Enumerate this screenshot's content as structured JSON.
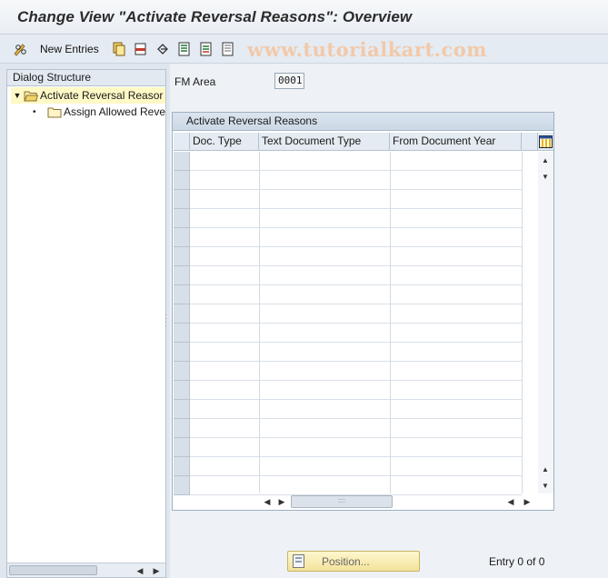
{
  "title": "Change View \"Activate Reversal Reasons\": Overview",
  "toolbar": {
    "new_entries_label": "New Entries",
    "watermark": "www.tutorialkart.com"
  },
  "dialog_structure": {
    "header": "Dialog Structure",
    "items": [
      {
        "label": "Activate Reversal Reasor",
        "selected": true
      },
      {
        "label": "Assign Allowed Reve",
        "selected": false
      }
    ]
  },
  "fm_area": {
    "label": "FM Area",
    "value": "0001"
  },
  "table": {
    "title": "Activate Reversal Reasons",
    "columns": [
      "Doc. Type",
      "Text Document Type",
      "From Document Year"
    ],
    "rows": []
  },
  "position_button": "Position...",
  "entry_info": "Entry 0 of 0",
  "colors": {
    "selected_bg": "#fff9c6",
    "button_yellow": "#f3e39a",
    "title_bar": "#e9eef4"
  }
}
